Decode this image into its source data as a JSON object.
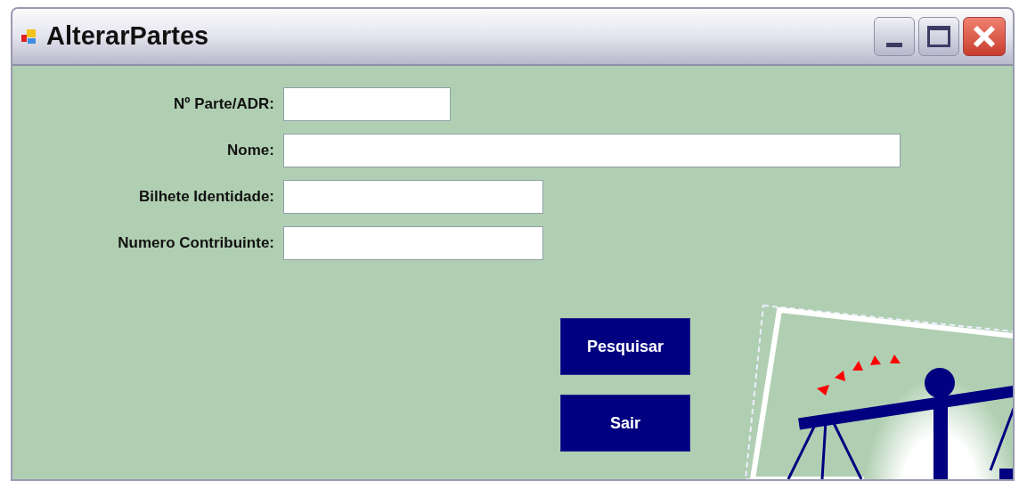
{
  "window": {
    "title": "AlterarPartes"
  },
  "fields": [
    {
      "label": "Nº Parte/ADR:"
    },
    {
      "label": "Nome:"
    },
    {
      "label": "Bilhete Identidade:"
    },
    {
      "label": "Numero Contribuinte:"
    }
  ],
  "buttons": [
    "Pesquisar",
    "Sair"
  ]
}
